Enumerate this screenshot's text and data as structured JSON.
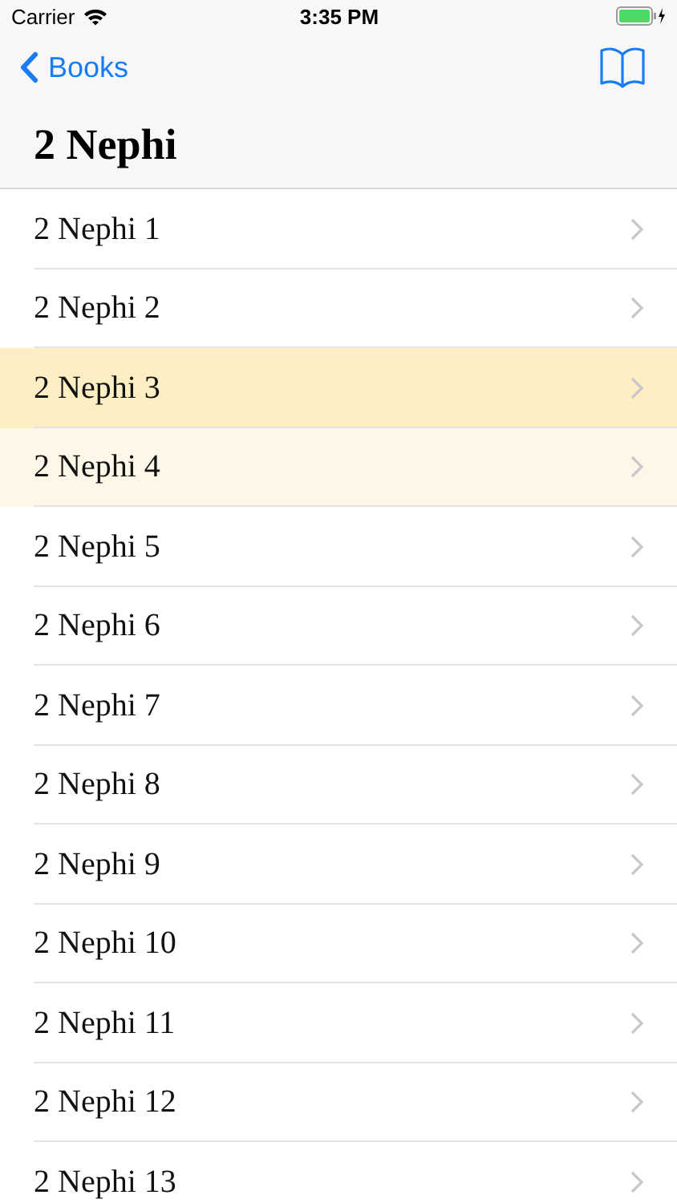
{
  "status_bar": {
    "carrier": "Carrier",
    "time": "3:35 PM"
  },
  "nav": {
    "back": "Books"
  },
  "title": "2 Nephi",
  "rows": [
    {
      "label": "2 Nephi 1",
      "selected": false,
      "visited": false
    },
    {
      "label": "2 Nephi 2",
      "selected": false,
      "visited": false
    },
    {
      "label": "2 Nephi 3",
      "selected": true,
      "visited": false
    },
    {
      "label": "2 Nephi 4",
      "selected": false,
      "visited": true
    },
    {
      "label": "2 Nephi 5",
      "selected": false,
      "visited": false
    },
    {
      "label": "2 Nephi 6",
      "selected": false,
      "visited": false
    },
    {
      "label": "2 Nephi 7",
      "selected": false,
      "visited": false
    },
    {
      "label": "2 Nephi 8",
      "selected": false,
      "visited": false
    },
    {
      "label": "2 Nephi 9",
      "selected": false,
      "visited": false
    },
    {
      "label": "2 Nephi 10",
      "selected": false,
      "visited": false
    },
    {
      "label": "2 Nephi 11",
      "selected": false,
      "visited": false
    },
    {
      "label": "2 Nephi 12",
      "selected": false,
      "visited": false
    },
    {
      "label": "2 Nephi 13",
      "selected": false,
      "visited": false
    }
  ]
}
